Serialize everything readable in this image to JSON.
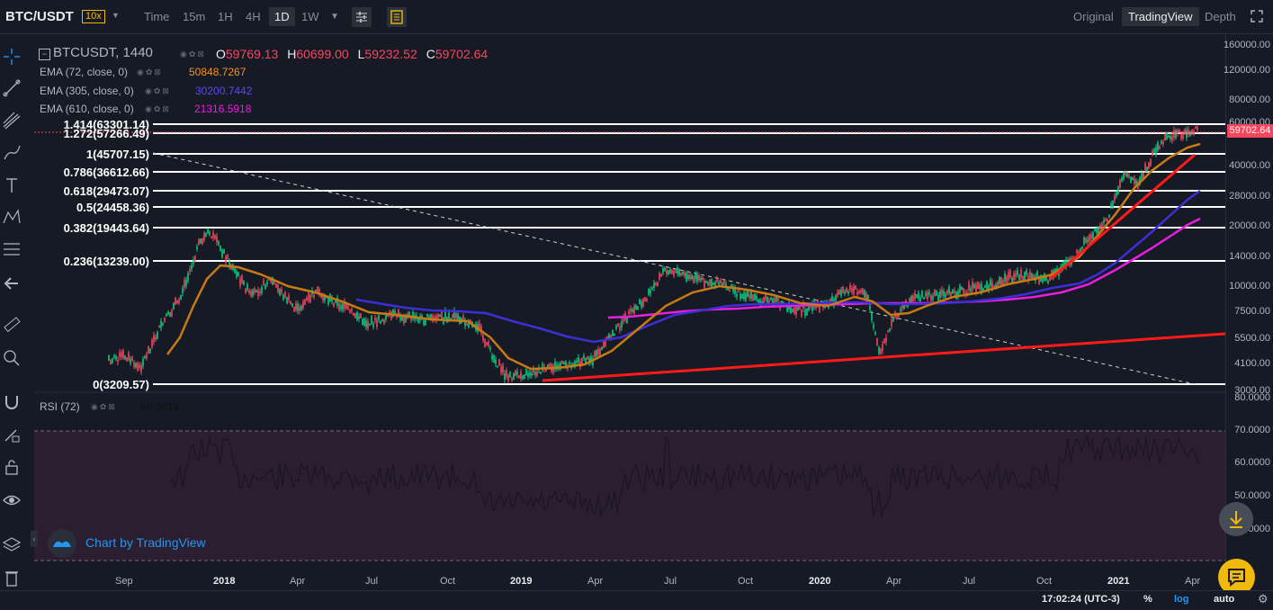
{
  "header": {
    "pair": "BTC/USDT",
    "leverage": "10x",
    "timeframes": [
      "Time",
      "15m",
      "1H",
      "4H",
      "1D",
      "1W"
    ],
    "active_timeframe": "1D",
    "views": [
      "Original",
      "TradingView",
      "Depth"
    ],
    "active_view": "TradingView"
  },
  "legend": {
    "symbol": "BTCUSDT, 1440",
    "open_key": "O",
    "open": "59769.13",
    "high_key": "H",
    "high": "60699.00",
    "low_key": "L",
    "low": "59232.52",
    "close_key": "C",
    "close": "59702.64",
    "ema": [
      {
        "label": "EMA (72, close, 0)",
        "value": "50848.7267",
        "color": "#f7931a"
      },
      {
        "label": "EMA (305, close, 0)",
        "value": "30200.7442",
        "color": "#3d2fd8"
      },
      {
        "label": "EMA (610, close, 0)",
        "value": "21316.5918",
        "color": "#e91ee0"
      }
    ]
  },
  "fib_levels": [
    {
      "label": "1.414(63301.14)"
    },
    {
      "label": "1.272(57266.49)"
    },
    {
      "label": "1(45707.15)"
    },
    {
      "label": "0.786(36612.66)"
    },
    {
      "label": "0.618(29473.07)"
    },
    {
      "label": "0.5(24458.36)"
    },
    {
      "label": "0.382(19443.64)"
    },
    {
      "label": "0.236(13239.00)"
    },
    {
      "label": "0(3209.57)"
    }
  ],
  "price_axis": {
    "ticks": [
      "160000.00",
      "120000.00",
      "80000.00",
      "60000.00",
      "40000.00",
      "28000.00",
      "20000.00",
      "14000.00",
      "10000.00",
      "7500.00",
      "5500.00",
      "4100.00",
      "3000.00"
    ],
    "last_price": "59702.64",
    "rsi_ticks": [
      "80.0000",
      "70.0000",
      "60.0000",
      "50.0000",
      "40.0000"
    ]
  },
  "time_axis": {
    "ticks": [
      {
        "label": "Sep",
        "bold": false
      },
      {
        "label": "2018",
        "bold": true
      },
      {
        "label": "Apr",
        "bold": false
      },
      {
        "label": "Jul",
        "bold": false
      },
      {
        "label": "Oct",
        "bold": false
      },
      {
        "label": "2019",
        "bold": true
      },
      {
        "label": "Apr",
        "bold": false
      },
      {
        "label": "Jul",
        "bold": false
      },
      {
        "label": "Oct",
        "bold": false
      },
      {
        "label": "2020",
        "bold": true
      },
      {
        "label": "Apr",
        "bold": false
      },
      {
        "label": "Jul",
        "bold": false
      },
      {
        "label": "Oct",
        "bold": false
      },
      {
        "label": "2021",
        "bold": true
      },
      {
        "label": "Apr",
        "bold": false
      }
    ]
  },
  "rsi": {
    "label": "RSI (72)",
    "value": "60.3614"
  },
  "branding": {
    "text": "Chart by TradingView"
  },
  "footer": {
    "time": "17:02:24 (UTC-3)",
    "percent": "%",
    "log": "log",
    "auto": "auto"
  },
  "colors": {
    "background": "#161a25",
    "up": "#0ecb81",
    "down": "#f6465d",
    "accent": "#f0b90b",
    "rsi_band": "#2b1e30"
  }
}
